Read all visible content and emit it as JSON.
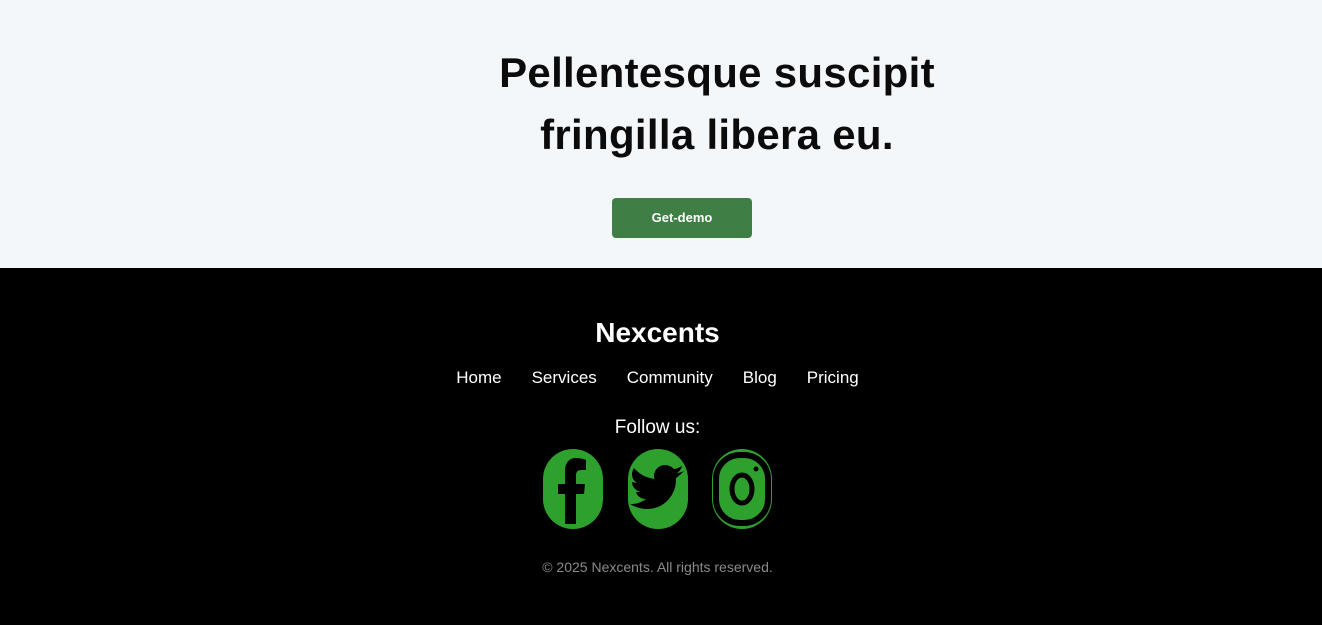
{
  "cta": {
    "title_line1": "Pellentesque suscipit",
    "title_line2": "fringilla libera eu.",
    "button_label": "Get-demo"
  },
  "footer": {
    "brand": "Nexcents",
    "nav": [
      "Home",
      "Services",
      "Community",
      "Blog",
      "Pricing"
    ],
    "follow_label": "Follow us:",
    "social": [
      {
        "icon": "facebook-icon"
      },
      {
        "icon": "twitter-icon"
      },
      {
        "icon": "instagram-icon"
      }
    ],
    "copyright": "© 2025 Nexcents. All rights reserved."
  },
  "colors": {
    "cta_background": "#f4f7fa",
    "button": "#3f7e45",
    "footer_background": "#000000",
    "social_icon": "#2ea02e",
    "copyright_text": "#8a8a8a"
  }
}
